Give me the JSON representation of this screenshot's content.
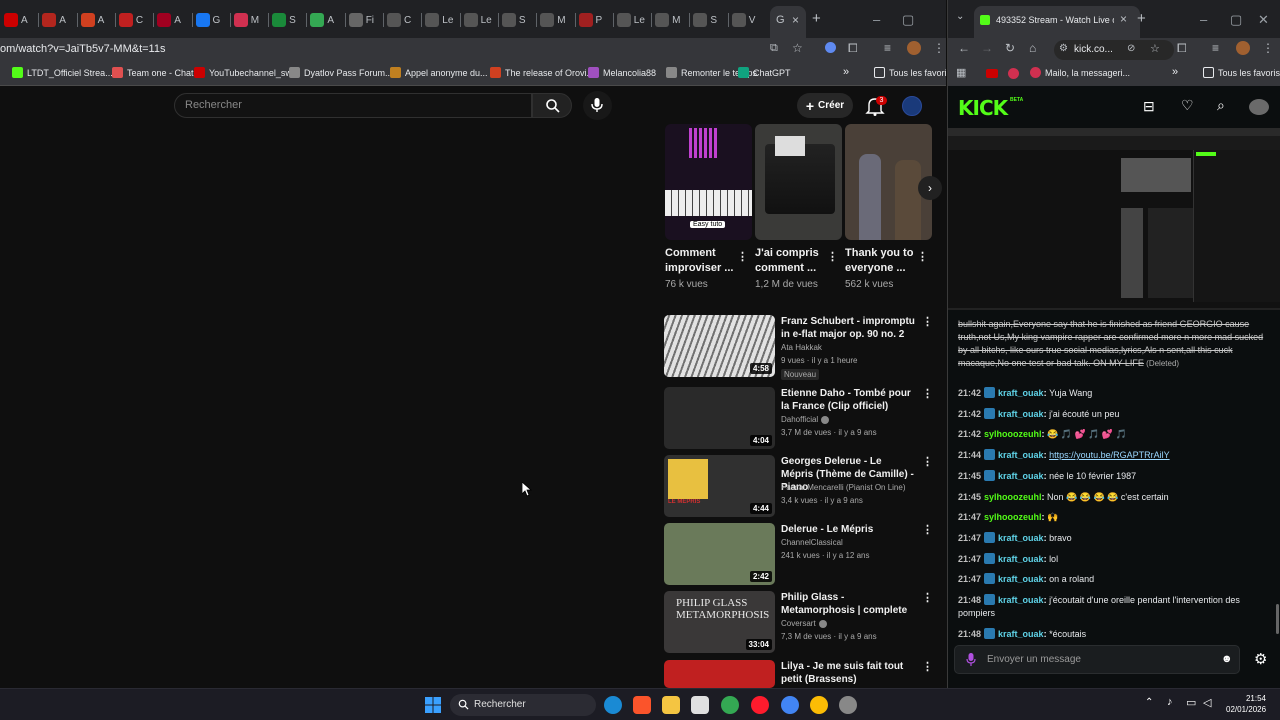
{
  "left_browser": {
    "tabs": [
      {
        "icon_name": "youtube-icon",
        "label": "A",
        "color": "#cc0000"
      },
      {
        "icon_name": "red-icon",
        "label": "A",
        "color": "#b3261e"
      },
      {
        "icon_name": "red-icon",
        "label": "A",
        "color": "#d04020"
      },
      {
        "icon_name": "red-icon",
        "label": "C",
        "color": "#c02020"
      },
      {
        "icon_name": "red-icon",
        "label": "A",
        "color": "#a00020"
      },
      {
        "icon_name": "facebook-icon",
        "label": "G",
        "color": "#1877f2"
      },
      {
        "icon_name": "red-icon",
        "label": "M",
        "color": "#d03050"
      },
      {
        "icon_name": "green-icon",
        "label": "S",
        "color": "#1a8a3a"
      },
      {
        "icon_name": "maps-icon",
        "label": "A",
        "color": "#34a853"
      },
      {
        "icon_name": "grey-icon",
        "label": "Fi",
        "color": "#666"
      },
      {
        "icon_name": "wiki-icon",
        "label": "C",
        "color": "#555"
      },
      {
        "icon_name": "globe-icon",
        "label": "Le",
        "color": "#555"
      },
      {
        "icon_name": "globe-icon",
        "label": "Le",
        "color": "#555"
      },
      {
        "icon_name": "wiki-icon",
        "label": "S",
        "color": "#555"
      },
      {
        "icon_name": "wiki-icon",
        "label": "M",
        "color": "#555"
      },
      {
        "icon_name": "red-icon",
        "label": "P",
        "color": "#a02020"
      },
      {
        "icon_name": "globe-icon",
        "label": "Le",
        "color": "#555"
      },
      {
        "icon_name": "globe-icon",
        "label": "M",
        "color": "#555"
      },
      {
        "icon_name": "wiki-icon",
        "label": "S",
        "color": "#555"
      },
      {
        "icon_name": "wiki-icon",
        "label": "V",
        "color": "#555"
      }
    ],
    "active_tab_glyph": "G",
    "url": "om/watch?v=JaiTb5v7-MM&t=11s",
    "bookmarks": [
      {
        "label": "LTDT_Officiel Strea...",
        "color": "#53fc18"
      },
      {
        "label": "Team one - Chat",
        "color": "#e05050"
      },
      {
        "label": "YouTubechannel_sw...",
        "color": "#cc0000"
      },
      {
        "label": "Dyatlov Pass Forum...",
        "color": "#888"
      },
      {
        "label": "Appel anonyme du...",
        "color": "#c08020"
      },
      {
        "label": "The release of Orovi...",
        "color": "#d04020"
      },
      {
        "label": "Melancolia88",
        "color": "#a050c0"
      },
      {
        "label": "Remonter le temps",
        "color": "#888"
      },
      {
        "label": "ChatGPT",
        "color": "#10a37f"
      }
    ],
    "bookmarks_folder": "Tous les favoris",
    "more_glyph": "»"
  },
  "youtube": {
    "search_placeholder": "Rechercher",
    "create_label": "Créer",
    "notification_count": "3",
    "shorts": [
      {
        "title": "Comment improviser ...",
        "views": "76 k vues",
        "thumb_color": "#1a1020",
        "tag": "Easy tuto"
      },
      {
        "title": "J'ai compris comment ...",
        "views": "1,2 M de vues",
        "thumb_color": "#3a3a38"
      },
      {
        "title": "Thank you to everyone ...",
        "views": "562 k vues",
        "thumb_color": "#4a4038"
      }
    ],
    "videos": [
      {
        "title": "Franz Schubert - impromptu in e-flat major op. 90 no. 2",
        "channel": "Ata Hakkak",
        "meta": "9 vues · il y a 1 heure",
        "badge": "Nouveau",
        "duration": "4:58",
        "thumb_color": "#d0d0d0",
        "verified": false
      },
      {
        "title": "Etienne Daho - Tombé pour la France (Clip officiel)",
        "channel": "Dahofficial",
        "meta": "3,7 M de vues · il y a 9 ans",
        "duration": "4:04",
        "thumb_color": "#2a2a2a",
        "verified": true
      },
      {
        "title": "Georges Delerue - Le Mépris (Thème de Camille) - Piano",
        "channel": "Pascal Mencarelli (Pianist On Line)",
        "meta": "3,4 k vues · il y a 9 ans",
        "duration": "4:44",
        "thumb_color": "#303030",
        "verified": false,
        "thumb_text": "LE MÉPRIS"
      },
      {
        "title": "Delerue - Le Mépris",
        "channel": "ChannelClassical",
        "meta": "241 k vues · il y a 12 ans",
        "duration": "2:42",
        "thumb_color": "#6a7a5a",
        "verified": false
      },
      {
        "title": "Philip Glass - Metamorphosis | complete",
        "channel": "Coversart",
        "meta": "7,3 M de vues · il y a 9 ans",
        "duration": "33:04",
        "thumb_color": "#3a3838",
        "verified": true,
        "thumb_text": "PHILIP GLASS\nMETAMORPHOSIS"
      },
      {
        "title": "Lilya - Je me suis fait tout petit (Brassens)",
        "channel": "",
        "meta": "",
        "duration": "",
        "thumb_color": "#c02020",
        "verified": false
      }
    ]
  },
  "right_browser": {
    "tab_title": "493352 Stream - Watch Live on",
    "url": "kick.co...",
    "bookmarks": [
      {
        "label": "Mailo, la messageri...",
        "color": "#d03050"
      }
    ],
    "bookmarks_folder": "Tous les favoris"
  },
  "kick": {
    "logo": "KICK",
    "beta": "BETA",
    "chat": [
      {
        "type": "deleted",
        "text": "bullshit again,Everyone say that he is finished as friend GEORGIO cause truth,not Us,My king vampire rapper are confirmed more n more mad sucked by all bitchs, like ours true social medias,lyrics,Als n sent,all this cuck macaque,No one test or bad talk. ON MY LIFE",
        "suffix": "(Deleted)"
      },
      {
        "time": "21:42",
        "user": "kraft_ouak",
        "color": "#5fd3e8",
        "badge": true,
        "text": "Yuja Wang"
      },
      {
        "time": "21:42",
        "user": "kraft_ouak",
        "color": "#5fd3e8",
        "badge": true,
        "text": "j'ai écouté un peu"
      },
      {
        "time": "21:42",
        "user": "sylhooozeuhl",
        "color": "#53fc18",
        "badge": false,
        "text": "😂 🎵 💕 🎵 💕 🎵"
      },
      {
        "time": "21:44",
        "user": "kraft_ouak",
        "color": "#5fd3e8",
        "badge": true,
        "text": "https://youtu.be/RGAPTRrAilY",
        "link": true
      },
      {
        "time": "21:45",
        "user": "kraft_ouak",
        "color": "#5fd3e8",
        "badge": true,
        "text": "née le 10 février 1987"
      },
      {
        "time": "21:45",
        "user": "sylhooozeuhl",
        "color": "#53fc18",
        "badge": false,
        "text": "Non 😂 😂 😂 😂 c'est certain"
      },
      {
        "time": "21:47",
        "user": "sylhooozeuhl",
        "color": "#53fc18",
        "badge": false,
        "text": "🙌"
      },
      {
        "time": "21:47",
        "user": "kraft_ouak",
        "color": "#5fd3e8",
        "badge": true,
        "text": "bravo"
      },
      {
        "time": "21:47",
        "user": "kraft_ouak",
        "color": "#5fd3e8",
        "badge": true,
        "text": "lol"
      },
      {
        "time": "21:47",
        "user": "kraft_ouak",
        "color": "#5fd3e8",
        "badge": true,
        "text": "on a roland"
      },
      {
        "time": "21:48",
        "user": "kraft_ouak",
        "color": "#5fd3e8",
        "badge": true,
        "text": "j'écoutait d'une oreille pendant l'intervention des pompiers"
      },
      {
        "time": "21:48",
        "user": "kraft_ouak",
        "color": "#5fd3e8",
        "badge": true,
        "text": "*écoutais"
      }
    ],
    "chat_placeholder": "Envoyer un message"
  },
  "taskbar": {
    "search_label": "Rechercher",
    "time": "21:54",
    "date": "02/01/2026",
    "apps": [
      {
        "name": "edge-icon",
        "color": "#1a8ad4"
      },
      {
        "name": "brave-icon",
        "color": "#fb542b"
      },
      {
        "name": "explorer-icon",
        "color": "#f4c542"
      },
      {
        "name": "notes-icon",
        "color": "#e0e0e0"
      },
      {
        "name": "chrome-icon",
        "color": "#34a853"
      },
      {
        "name": "opera-icon",
        "color": "#ff1b2d"
      },
      {
        "name": "chrome-icon",
        "color": "#4285f4"
      },
      {
        "name": "chrome-icon",
        "color": "#fbbc05"
      },
      {
        "name": "settings-icon",
        "color": "#888"
      }
    ]
  }
}
